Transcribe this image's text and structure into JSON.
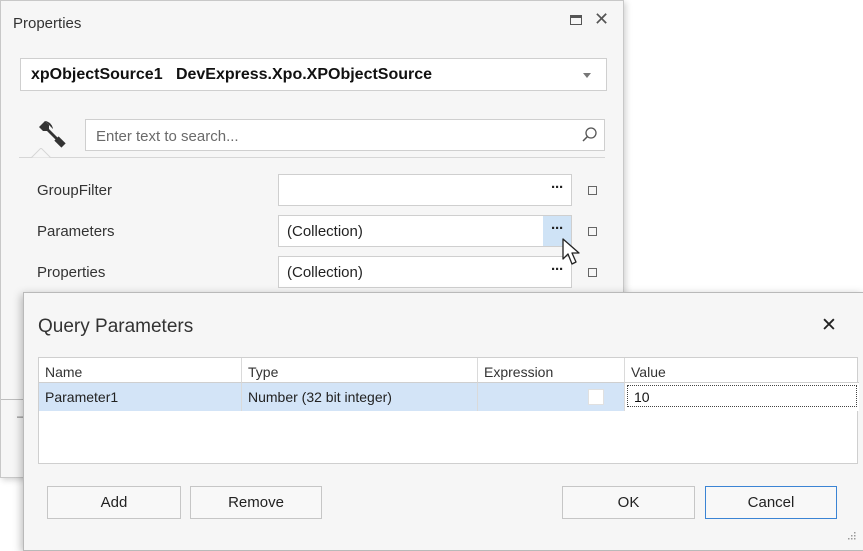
{
  "properties_panel": {
    "title": "Properties",
    "object_name": "xpObjectSource1   DevExpress.Xpo.XPObjectSource",
    "search": {
      "placeholder": "Enter text to search..."
    },
    "rows": [
      {
        "label": "GroupFilter",
        "value": ""
      },
      {
        "label": "Parameters",
        "value": "(Collection)"
      },
      {
        "label": "Properties",
        "value": "(Collection)"
      }
    ],
    "ellipsis": "···"
  },
  "dialog": {
    "title": "Query Parameters",
    "close_glyph": "✕",
    "columns": [
      "Name",
      "Type",
      "Expression",
      "Value"
    ],
    "rows": [
      {
        "name": "Parameter1",
        "type": "Number (32 bit integer)",
        "expression": false,
        "value": "10"
      }
    ],
    "buttons": {
      "add": "Add",
      "remove": "Remove",
      "ok": "OK",
      "cancel": "Cancel"
    }
  },
  "colors": {
    "accent": "#3b84d4",
    "selection": "#d3e4f7",
    "hot_button": "#cfe3f6"
  }
}
